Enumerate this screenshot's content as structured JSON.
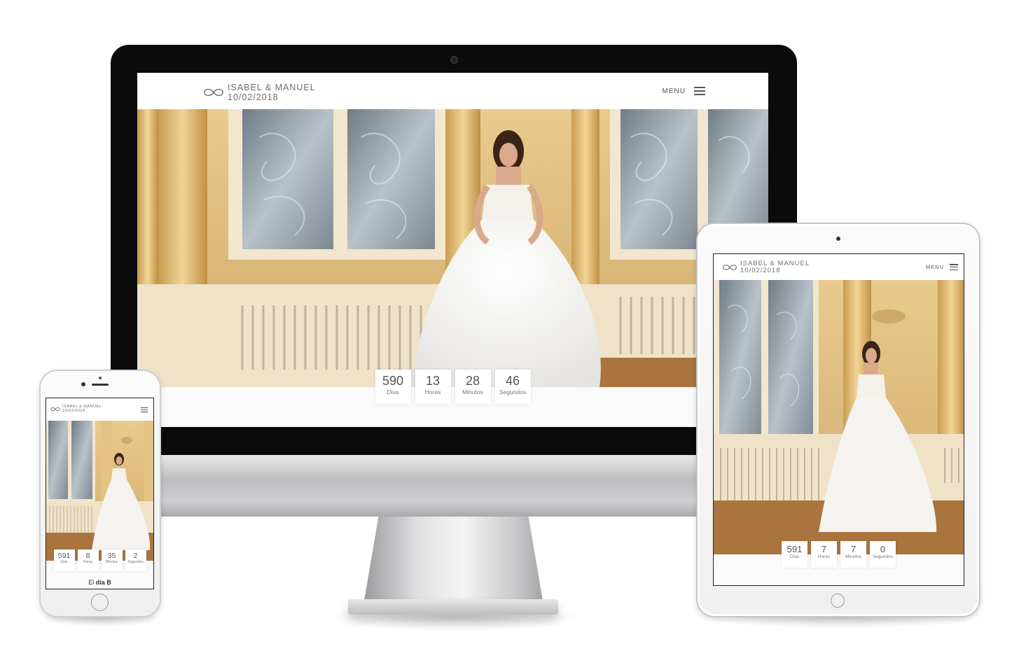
{
  "site": {
    "title": "ISABEL & MANUEL",
    "date": "10/02/2018",
    "menu_label": "MENU"
  },
  "icons": {
    "logo": "infinity-icon",
    "menu": "hamburger-icon"
  },
  "desktop": {
    "countdown": [
      {
        "value": "590",
        "label": "Días"
      },
      {
        "value": "13",
        "label": "Horas"
      },
      {
        "value": "28",
        "label": "Minutos"
      },
      {
        "value": "46",
        "label": "Segundos"
      }
    ]
  },
  "tablet": {
    "countdown": [
      {
        "value": "591",
        "label": "Días"
      },
      {
        "value": "7",
        "label": "Horas"
      },
      {
        "value": "7",
        "label": "Minutos"
      },
      {
        "value": "0",
        "label": "Segundos"
      }
    ]
  },
  "phone": {
    "countdown": [
      {
        "value": "591",
        "label": "Días"
      },
      {
        "value": "8",
        "label": "Horas"
      },
      {
        "value": "35",
        "label": "Minutos"
      },
      {
        "value": "2",
        "label": "Segundos"
      }
    ],
    "footer_prefix": "El",
    "footer_bold": "día B"
  },
  "colors": {
    "wall": "#e8c98b",
    "window_glass": "#8f9ba3",
    "floor": "#a9743d",
    "dress": "#f7f6f4",
    "bezel": "#0b0b0b"
  }
}
